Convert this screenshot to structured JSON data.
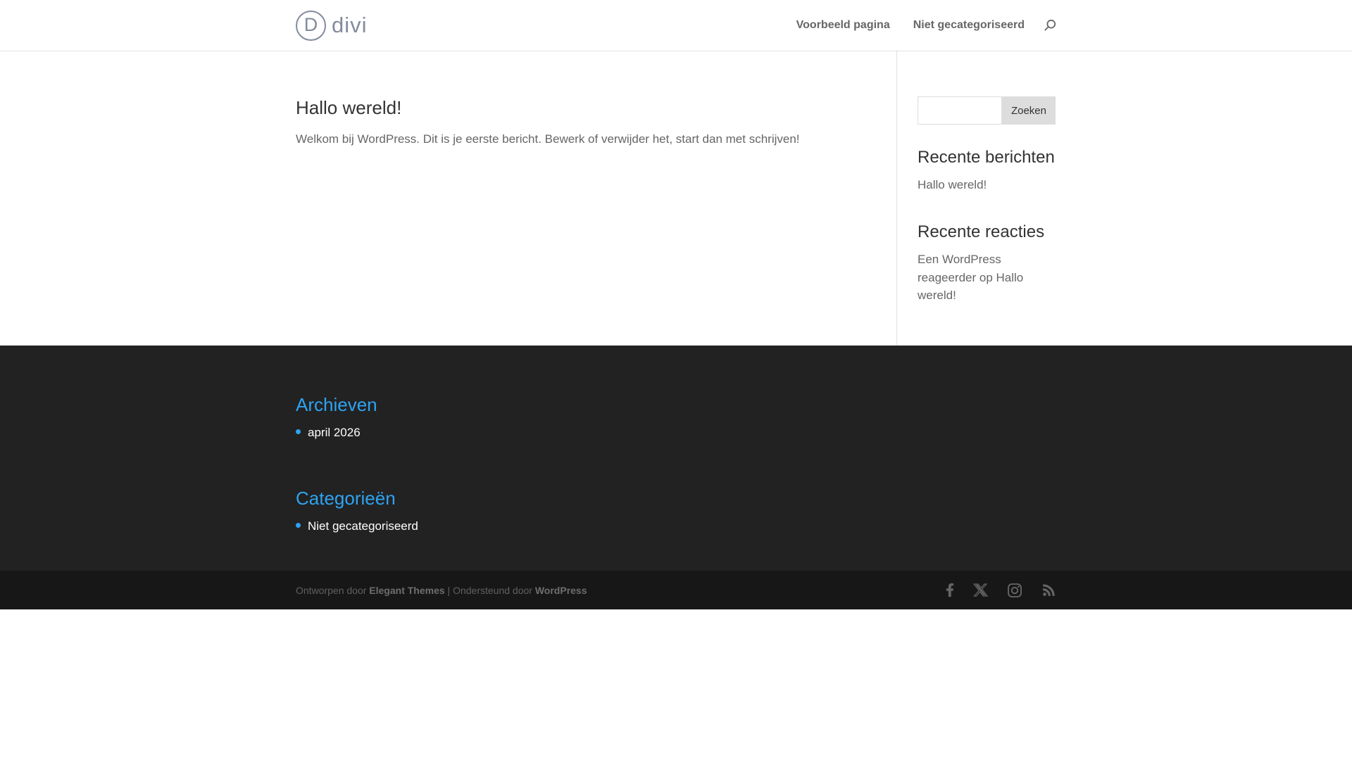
{
  "colors": {
    "accent_blue": "#2ea3f2",
    "footer_bg": "#222222",
    "bottom_bar_bg": "#171717",
    "text_dark": "#333333",
    "text_gray": "#666666",
    "logo_slate": "#838b9d",
    "button_bg": "#dddddd"
  },
  "header": {
    "logo": {
      "circle_letter": "D",
      "brand": "divi"
    },
    "nav": [
      {
        "label": "Voorbeeld pagina"
      },
      {
        "label": "Niet gecategoriseerd"
      }
    ],
    "search_icon": "magnifier-icon"
  },
  "main": {
    "post": {
      "title": "Hallo wereld!",
      "body": "Welkom bij WordPress. Dit is je eerste bericht. Bewerk of verwijder het, start dan met schrijven!"
    },
    "sidebar": {
      "search": {
        "button_label": "Zoeken",
        "input_value": ""
      },
      "widgets": [
        {
          "title": "Recente berichten",
          "items": [
            "Hallo wereld!"
          ]
        },
        {
          "title": "Recente reacties",
          "items": [
            "Een WordPress reageerder op Hallo wereld!"
          ]
        }
      ]
    }
  },
  "footer": {
    "widgets": [
      {
        "title": "Archieven",
        "items": [
          "april 2026"
        ]
      },
      {
        "title": "Categorieën",
        "items": [
          "Niet gecategoriseerd"
        ]
      }
    ],
    "credits": {
      "prefix": "Ontworpen door ",
      "theme_link": "Elegant Themes",
      "middle": " | Ondersteund door ",
      "platform_link": "WordPress"
    },
    "social": [
      "facebook",
      "x",
      "instagram",
      "rss"
    ]
  }
}
